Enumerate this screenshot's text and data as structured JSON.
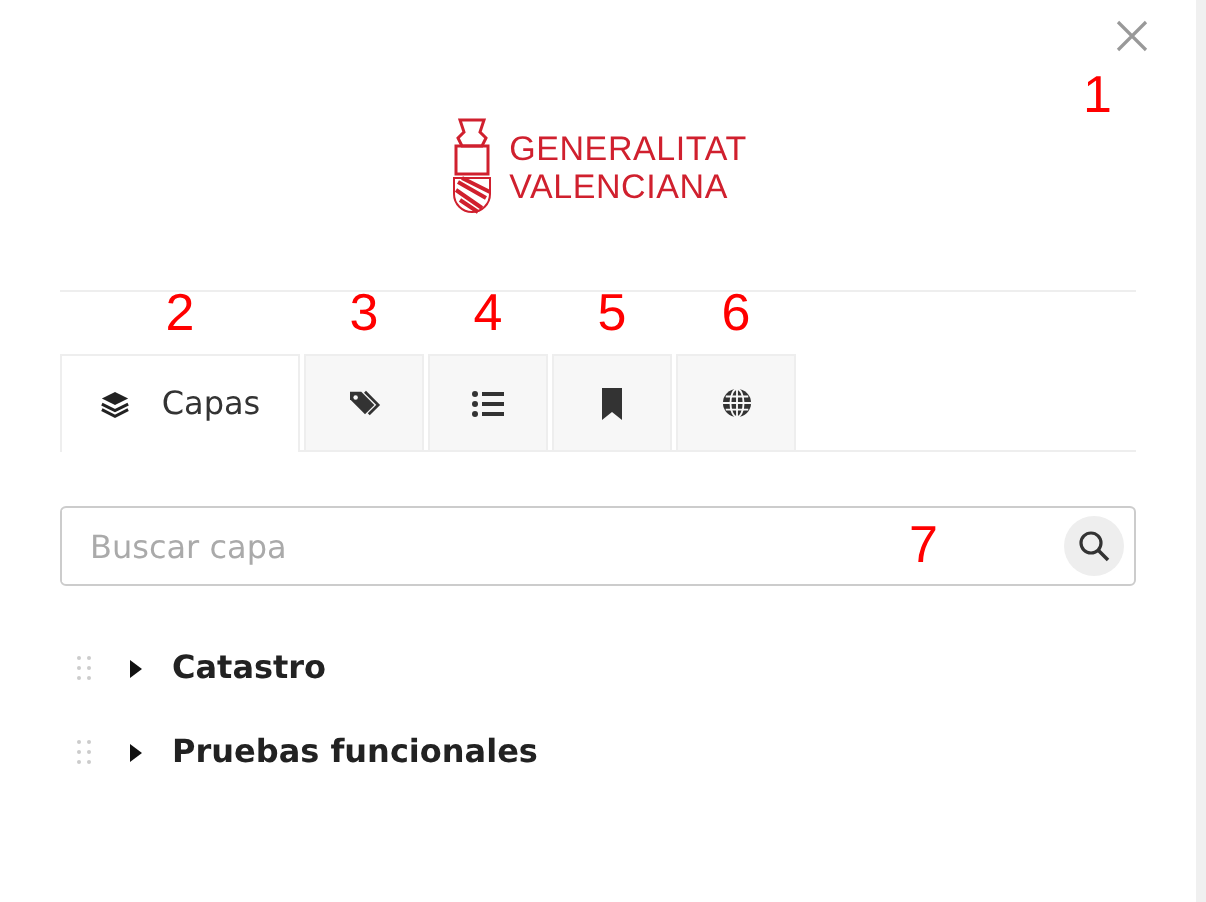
{
  "close_button": {
    "annotation": "1"
  },
  "logo": {
    "lines": [
      "GENERALITAT",
      "VALENCIANA"
    ]
  },
  "tabs": [
    {
      "kind": "layers",
      "label": "Capas",
      "selected": true,
      "annotation": "2"
    },
    {
      "kind": "tags",
      "selected": false,
      "annotation": "3"
    },
    {
      "kind": "list",
      "selected": false,
      "annotation": "4"
    },
    {
      "kind": "bookmark",
      "selected": false,
      "annotation": "5"
    },
    {
      "kind": "globe",
      "selected": false,
      "annotation": "6"
    }
  ],
  "search": {
    "placeholder": "Buscar capa",
    "annotation": "7"
  },
  "layers": [
    {
      "name": "Catastro",
      "expanded": false
    },
    {
      "name": "Pruebas funcionales",
      "expanded": false
    }
  ]
}
